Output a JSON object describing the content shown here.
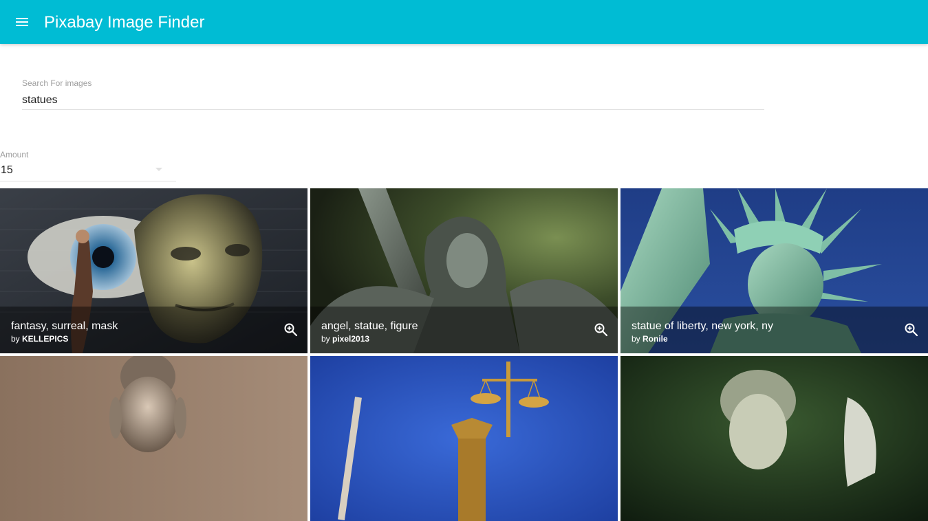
{
  "appbar": {
    "title": "Pixabay Image Finder",
    "menu_icon": "hamburger-menu-icon",
    "color": "#00bcd4"
  },
  "search": {
    "label": "Search For images",
    "value": "statues"
  },
  "amount": {
    "label": "Amount",
    "value": "15"
  },
  "images": [
    {
      "title": "fantasy, surreal, mask",
      "by_prefix": "by ",
      "author": "KELLEPICS"
    },
    {
      "title": "angel, statue, figure",
      "by_prefix": "by ",
      "author": "pixel2013"
    },
    {
      "title": "statue of liberty, new york, ny",
      "by_prefix": "by ",
      "author": "Ronile"
    },
    {
      "title": "",
      "by_prefix": "",
      "author": ""
    },
    {
      "title": "",
      "by_prefix": "",
      "author": ""
    },
    {
      "title": "",
      "by_prefix": "",
      "author": ""
    }
  ]
}
